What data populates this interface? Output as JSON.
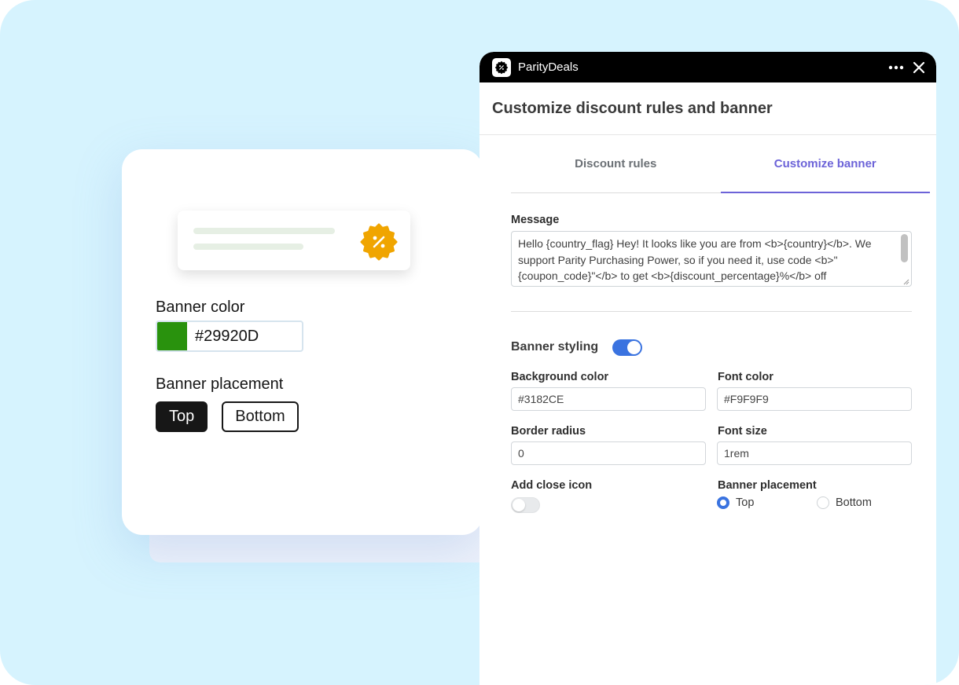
{
  "left_card": {
    "banner_color_label": "Banner color",
    "banner_color_value": "#29920D",
    "banner_placement_label": "Banner placement",
    "placement_top": "Top",
    "placement_bottom": "Bottom",
    "selected_placement": "Top",
    "icons": {
      "badge": "discount-badge-icon"
    }
  },
  "window": {
    "app_name": "ParityDeals",
    "icons": {
      "logo": "paritydeals-logo-icon",
      "more": "more-dots-icon",
      "close": "close-icon"
    }
  },
  "panel": {
    "title": "Customize discount rules and banner",
    "tabs": [
      {
        "label": "Discount rules",
        "active": false
      },
      {
        "label": "Customize banner",
        "active": true
      }
    ],
    "message_label": "Message",
    "message_value": "Hello {country_flag} Hey! It looks like you are from <b>{country}</b>. We support Parity Purchasing Power, so if you need it, use code <b>\"{coupon_code}\"</b> to get <b>{discount_percentage}%</b> off",
    "banner_styling_label": "Banner styling",
    "banner_styling_enabled": true,
    "background_color_label": "Background color",
    "background_color_value": "#3182CE",
    "font_color_label": "Font color",
    "font_color_value": "#F9F9F9",
    "border_radius_label": "Border radius",
    "border_radius_value": "0",
    "font_size_label": "Font size",
    "font_size_value": "1rem",
    "add_close_icon_label": "Add close icon",
    "add_close_icon_enabled": false,
    "banner_placement_label": "Banner placement",
    "placement_top": "Top",
    "placement_bottom": "Bottom",
    "selected_placement": "Top"
  },
  "colors": {
    "background": "#d6f3fe",
    "accent_tab": "#6c63d8",
    "toggle_on": "#3a73e0",
    "badge": "#f0a500",
    "swatch": "#29920D"
  }
}
